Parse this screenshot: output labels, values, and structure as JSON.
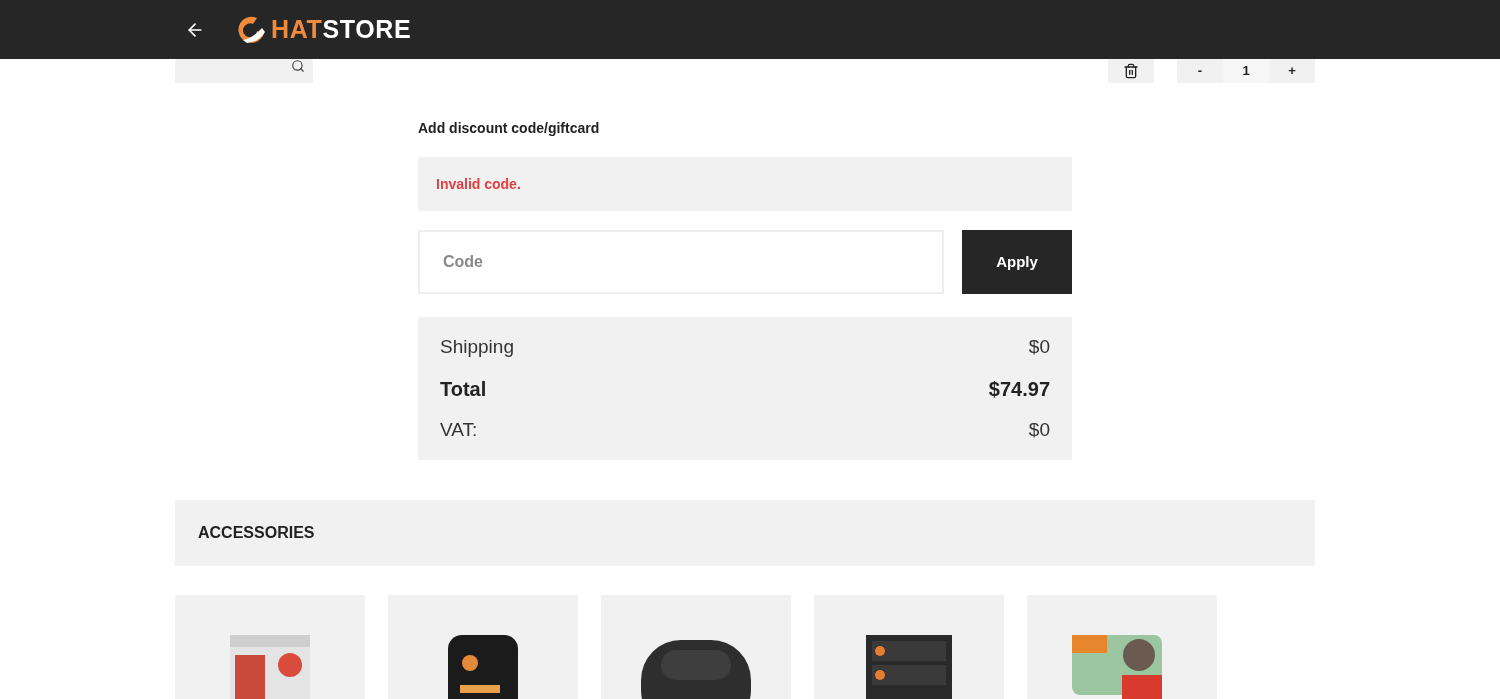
{
  "header": {
    "logo": {
      "part_1": "HAT",
      "part_2": "STORE"
    }
  },
  "cart_row": {
    "quantity": {
      "decrease": "-",
      "value": "1",
      "increase": "+"
    }
  },
  "discount": {
    "title": "Add discount code/giftcard",
    "error": "Invalid code.",
    "code_field": {
      "placeholder": "Code"
    },
    "apply_button": "Apply"
  },
  "summary": [
    {
      "kind": "normal",
      "label": "Shipping",
      "value": "$0"
    },
    {
      "kind": "total",
      "label": "Total",
      "value": "$74.97"
    },
    {
      "kind": "normal",
      "label": "VAT:",
      "value": "$0"
    }
  ],
  "accessories": {
    "title": "ACCESSORIES"
  }
}
